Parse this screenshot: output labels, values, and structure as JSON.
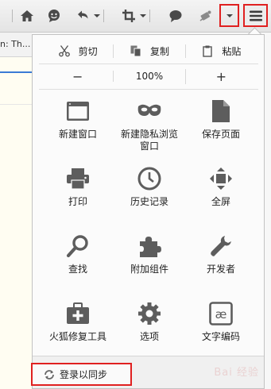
{
  "browser": {
    "tab_snippet": "n: Th..."
  },
  "toolbar": {
    "icons": [
      "home-icon",
      "chat-icon",
      "undo-icon",
      "crop-icon",
      "comment-icon",
      "extension-icon",
      "menu-icon"
    ]
  },
  "panel": {
    "edit": {
      "cut": "剪切",
      "copy": "复制",
      "paste": "粘贴"
    },
    "zoom": {
      "minus": "−",
      "level": "100%",
      "plus": "+"
    },
    "items": [
      {
        "label": "新建窗口",
        "icon": "new-window-icon"
      },
      {
        "label": "新建隐私浏览窗口",
        "icon": "private-mask-icon"
      },
      {
        "label": "保存页面",
        "icon": "save-page-icon"
      },
      {
        "label": "打印",
        "icon": "print-icon"
      },
      {
        "label": "历史记录",
        "icon": "history-icon"
      },
      {
        "label": "全屏",
        "icon": "fullscreen-icon"
      },
      {
        "label": "查找",
        "icon": "find-icon"
      },
      {
        "label": "附加组件",
        "icon": "addons-icon"
      },
      {
        "label": "开发者",
        "icon": "developer-icon"
      },
      {
        "label": "火狐修复工具",
        "icon": "repair-tool-icon"
      },
      {
        "label": "选项",
        "icon": "options-gear-icon"
      },
      {
        "label": "文字编码",
        "icon": "text-encoding-icon"
      }
    ],
    "signin_label": "登录以同步"
  },
  "watermark": "Bai 经验",
  "colors": {
    "highlight": "#e02020",
    "icon": "#555555",
    "panel_bg": "#fbfbfb"
  }
}
